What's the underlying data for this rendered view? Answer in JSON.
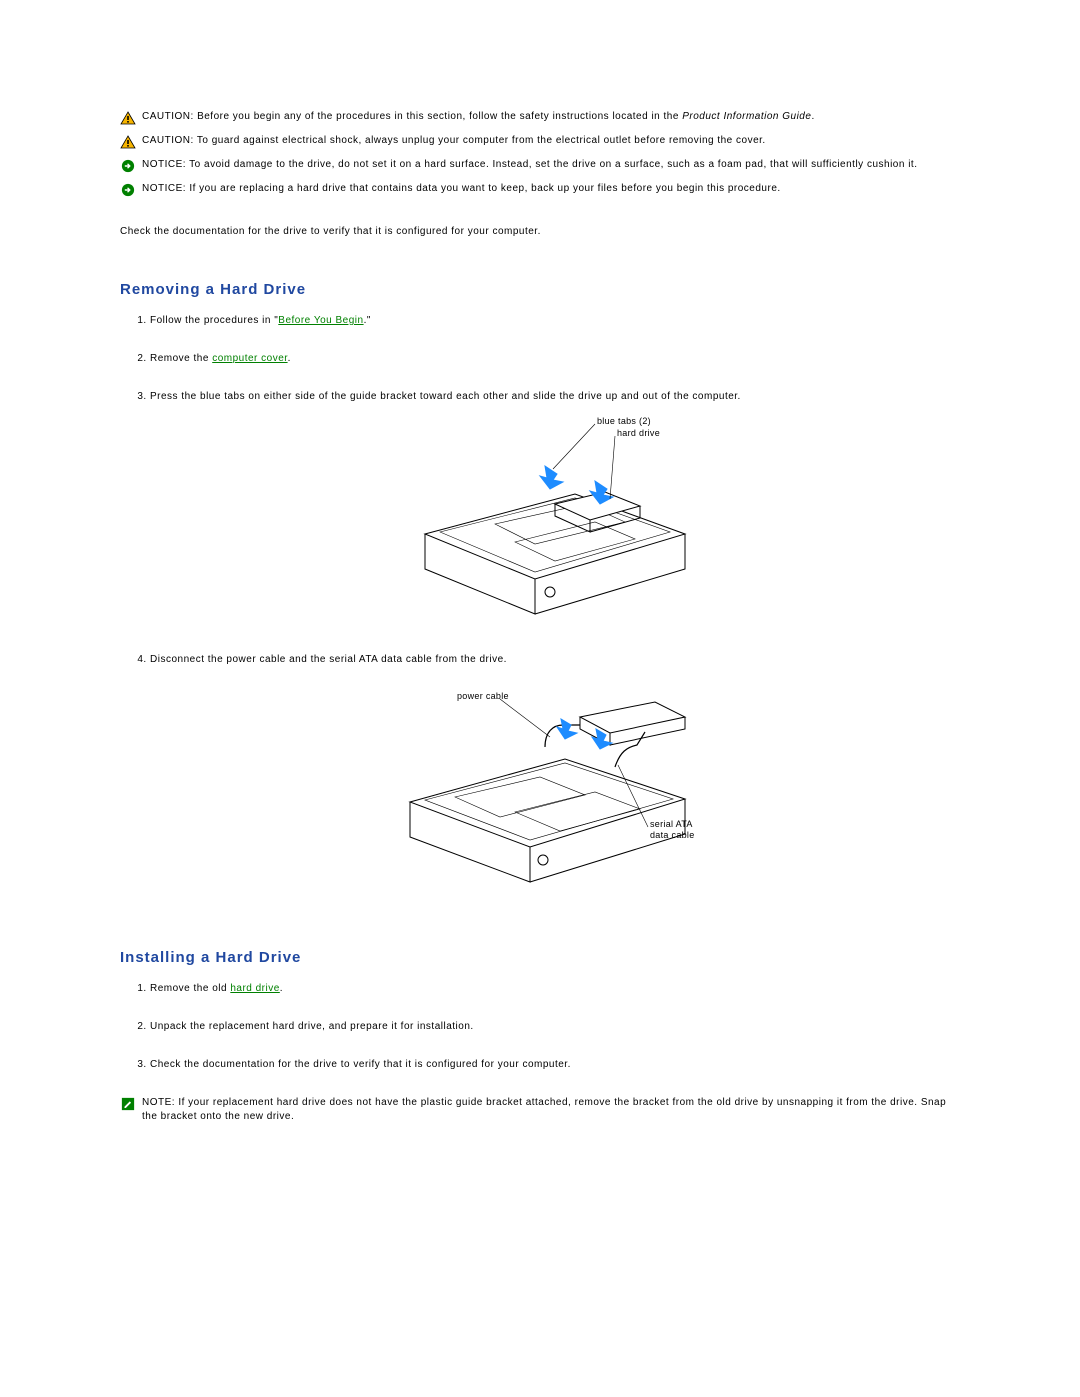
{
  "alerts": {
    "caution1": {
      "lead": "CAUTION:",
      "text_a": "Before you begin any of the procedures in this section, follow the safety instructions located in the ",
      "text_b": "Product Information Guide",
      "text_c": "."
    },
    "caution2": {
      "lead": "CAUTION:",
      "text": "To guard against electrical shock, always unplug your computer from the electrical outlet before removing the cover."
    },
    "notice1": {
      "lead": "NOTICE:",
      "text": "To avoid damage to the drive, do not set it on a hard surface. Instead, set the drive on a surface, such as a foam pad, that will sufficiently cushion it."
    },
    "notice2": {
      "lead": "NOTICE:",
      "text": "If you are replacing a hard drive that contains data you want to keep, back up your files before you begin this procedure."
    }
  },
  "para1": "Check the documentation for the drive to verify that it is configured for your computer.",
  "section_removing": {
    "title": "Removing a Hard Drive",
    "step1_a": "Follow the procedures in \"",
    "step1_link": "Before You Begin",
    "step1_b": ".\"",
    "step2_a": "Remove the ",
    "step2_link": "computer cover",
    "step2_b": ".",
    "step3": "Press the blue tabs on either side of the guide bracket toward each other and slide the drive up and out of the computer.",
    "fig1_label1": "blue tabs (2)",
    "fig1_label2": "hard drive",
    "step4": "Disconnect the power cable and the serial ATA data cable from the drive.",
    "fig2_label1": "power cable",
    "fig2_label2a": "serial ATA",
    "fig2_label2b": "data cable"
  },
  "section_installing": {
    "title": "Installing a Hard Drive",
    "step1_a": "Remove the old ",
    "step1_link": "hard drive",
    "step1_b": ".",
    "step2": "Unpack the replacement hard drive, and prepare it for installation.",
    "step3": "Check the documentation for the drive to verify that it is configured for your computer."
  },
  "note": {
    "lead": "NOTE:",
    "text": "If your replacement hard drive does not have the plastic guide bracket attached, remove the bracket from the old drive by unsnapping it from the drive. Snap the bracket onto the new drive."
  }
}
